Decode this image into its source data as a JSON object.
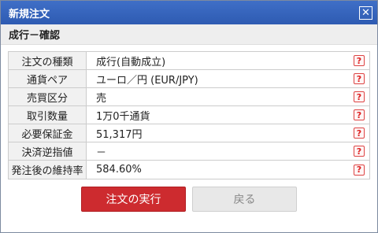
{
  "window": {
    "title": "新規注文",
    "close_glyph": "✕"
  },
  "section": {
    "title": "成行－確認"
  },
  "rows": [
    {
      "label": "注文の種類",
      "value": "成行(自動成立)",
      "help": "?"
    },
    {
      "label": "通貨ペア",
      "value": "ユーロ／円 (EUR/JPY)",
      "help": "?"
    },
    {
      "label": "売買区分",
      "value": "売",
      "help": "?"
    },
    {
      "label": "取引数量",
      "value": "1万0千通貨",
      "help": "?"
    },
    {
      "label": "必要保証金",
      "value": "51,317円",
      "help": "?"
    },
    {
      "label": "決済逆指値",
      "value": "－",
      "help": "?"
    },
    {
      "label": "発注後の維持率",
      "value": "584.60%",
      "help": "?"
    }
  ],
  "buttons": {
    "execute": "注文の実行",
    "back": "戻る"
  },
  "colors": {
    "titlebar": "#3568c0",
    "execute": "#cd2b2f",
    "help": "#d22222"
  }
}
